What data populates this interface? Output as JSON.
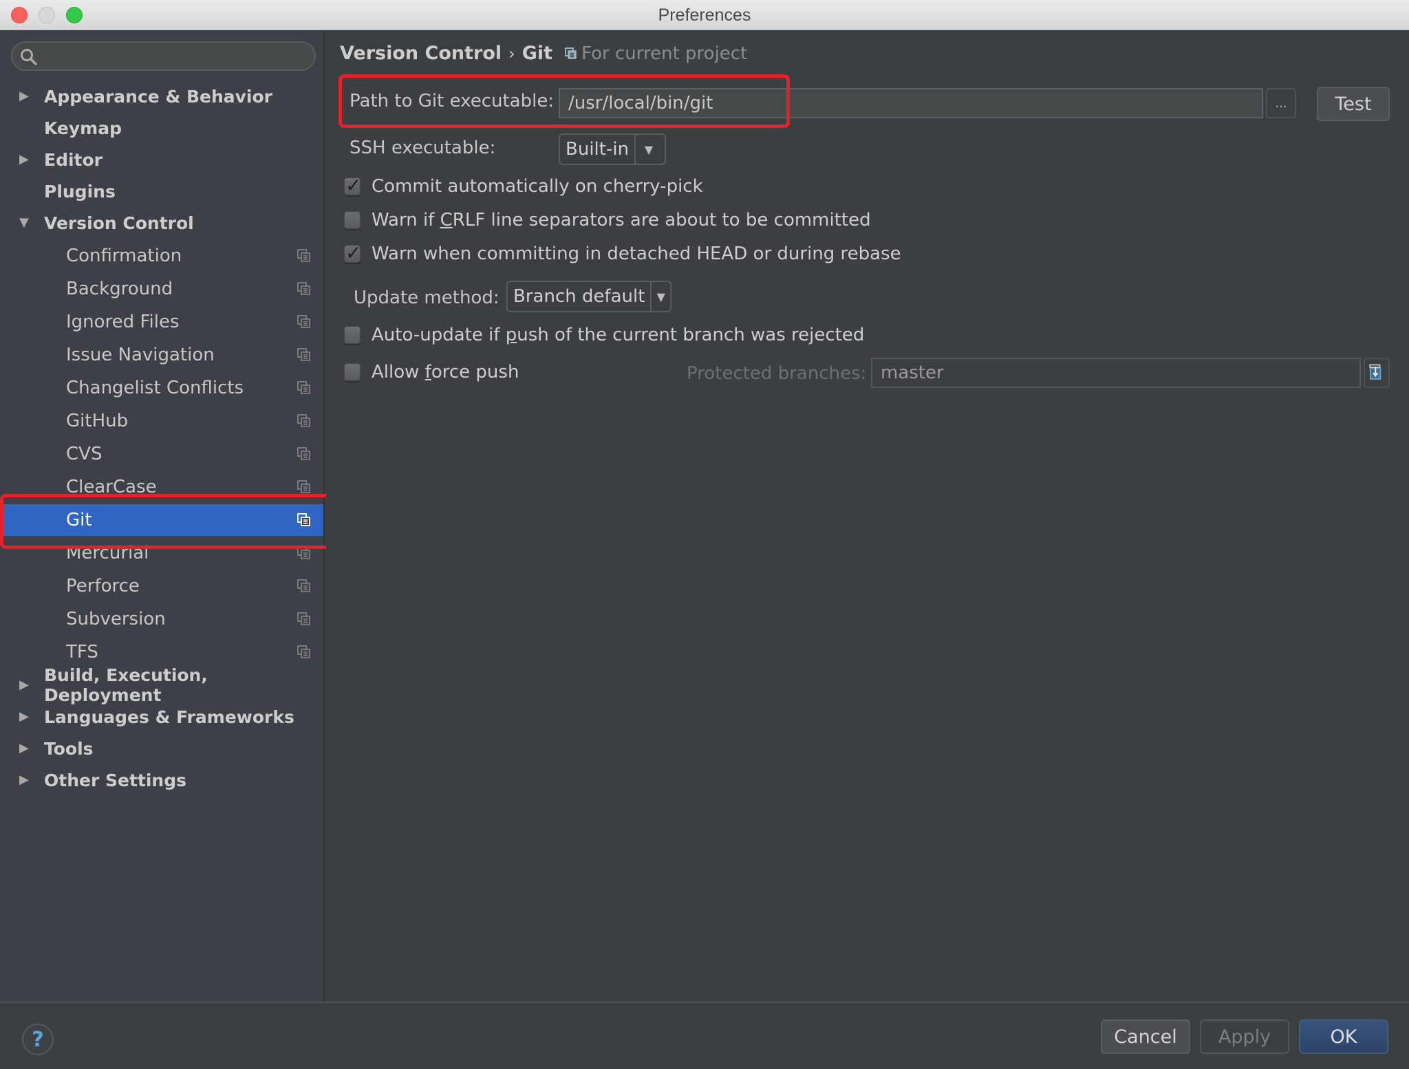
{
  "window": {
    "title": "Preferences"
  },
  "sidebar": {
    "search": {
      "placeholder": "",
      "value": ""
    },
    "items": [
      {
        "label": "Appearance & Behavior",
        "level": 0,
        "expandable": true,
        "expanded": false
      },
      {
        "label": "Keymap",
        "level": 0,
        "expandable": false
      },
      {
        "label": "Editor",
        "level": 0,
        "expandable": true,
        "expanded": false
      },
      {
        "label": "Plugins",
        "level": 0,
        "expandable": false
      },
      {
        "label": "Version Control",
        "level": 0,
        "expandable": true,
        "expanded": true
      },
      {
        "label": "Confirmation",
        "level": 1,
        "project_icon": true
      },
      {
        "label": "Background",
        "level": 1,
        "project_icon": true
      },
      {
        "label": "Ignored Files",
        "level": 1,
        "project_icon": true
      },
      {
        "label": "Issue Navigation",
        "level": 1,
        "project_icon": true
      },
      {
        "label": "Changelist Conflicts",
        "level": 1,
        "project_icon": true
      },
      {
        "label": "GitHub",
        "level": 1,
        "project_icon": true
      },
      {
        "label": "CVS",
        "level": 1,
        "project_icon": true
      },
      {
        "label": "ClearCase",
        "level": 1,
        "project_icon": true
      },
      {
        "label": "Git",
        "level": 1,
        "project_icon": true,
        "selected": true
      },
      {
        "label": "Mercurial",
        "level": 1,
        "project_icon": true
      },
      {
        "label": "Perforce",
        "level": 1,
        "project_icon": true
      },
      {
        "label": "Subversion",
        "level": 1,
        "project_icon": true
      },
      {
        "label": "TFS",
        "level": 1,
        "project_icon": true
      },
      {
        "label": "Build, Execution, Deployment",
        "level": 0,
        "expandable": true,
        "expanded": false
      },
      {
        "label": "Languages & Frameworks",
        "level": 0,
        "expandable": true,
        "expanded": false
      },
      {
        "label": "Tools",
        "level": 0,
        "expandable": true,
        "expanded": false
      },
      {
        "label": "Other Settings",
        "level": 0,
        "expandable": true,
        "expanded": false
      }
    ]
  },
  "breadcrumb": {
    "parts": [
      "Version Control",
      "Git"
    ],
    "separator": "›",
    "scope_note": "For current project"
  },
  "git_settings": {
    "path_label": "Path to Git executable:",
    "path_value": "/usr/local/bin/git",
    "browse_label": "...",
    "test_label": "Test",
    "ssh_label": "SSH executable:",
    "ssh_value": "Built-in",
    "checkboxes": [
      {
        "pre": "Commit automatically on cherry-pick",
        "mnemonic": "",
        "post": "",
        "checked": true
      },
      {
        "pre": "Warn if ",
        "mnemonic": "C",
        "post": "RLF line separators are about to be committed",
        "checked": false
      },
      {
        "pre": "Warn when committing in detached HEAD or during rebase",
        "mnemonic": "",
        "post": "",
        "checked": true
      }
    ],
    "update_method_label": "Update method:",
    "update_method_value": "Branch default",
    "auto_update": {
      "pre": "Auto-update if ",
      "mnemonic": "p",
      "post": "ush of the current branch was rejected",
      "checked": false
    },
    "force_push": {
      "pre": "Allow ",
      "mnemonic": "f",
      "post": "orce push",
      "checked": false
    },
    "protected_branches_label": "Protected branches:",
    "protected_branches_value": "master"
  },
  "footer": {
    "help_label": "?",
    "cancel_label": "Cancel",
    "apply_label": "Apply",
    "ok_label": "OK"
  },
  "colors": {
    "selection": "#3065c4",
    "highlight_annotation": "#e8202a",
    "ok_button": "#2c4468",
    "help_icon": "#5aa7e0"
  }
}
